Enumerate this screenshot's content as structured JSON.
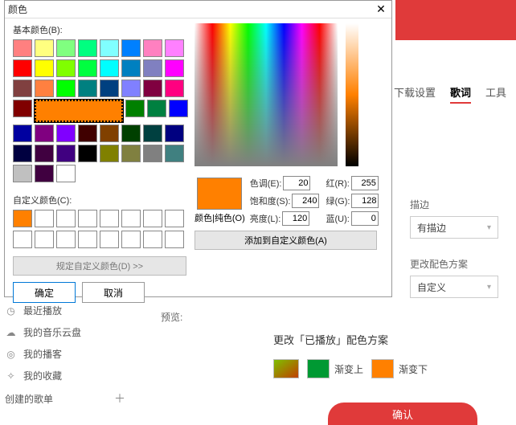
{
  "dialog": {
    "title": "颜色",
    "basic_label": "基本颜色(B):",
    "custom_label": "自定义颜色(C):",
    "define_btn": "规定自定义颜色(D) >>",
    "ok": "确定",
    "cancel": "取消",
    "preview_label": "颜色|纯色(O)",
    "add_btn": "添加到自定义颜色(A)",
    "basic_colors": [
      "#ff8080",
      "#ffff80",
      "#80ff80",
      "#00ff80",
      "#80ffff",
      "#0080ff",
      "#ff80c0",
      "#ff80ff",
      "#ff0000",
      "#ffff00",
      "#80ff00",
      "#00ff40",
      "#00ffff",
      "#0080c0",
      "#8080c0",
      "#ff00ff",
      "#804040",
      "#ff8040",
      "#00ff00",
      "#008080",
      "#004080",
      "#8080ff",
      "#800040",
      "#ff0080",
      "#800000",
      "#ff8000",
      "#008000",
      "#008040",
      "#0000ff",
      "#0000a0",
      "#800080",
      "#8000ff",
      "#400000",
      "#804000",
      "#004000",
      "#004040",
      "#000080",
      "#000040",
      "#400040",
      "#400080",
      "#000000",
      "#808000",
      "#808040",
      "#808080",
      "#408080",
      "#c0c0c0",
      "#400040",
      "#ffffff"
    ],
    "selected_index": 25,
    "custom_colors": [
      "#ff8000",
      "",
      "",
      "",
      "",
      "",
      "",
      "",
      "",
      "",
      "",
      "",
      "",
      "",
      "",
      ""
    ],
    "fields": {
      "hue_label": "色调(E):",
      "hue": "20",
      "sat_label": "饱和度(S):",
      "sat": "240",
      "lum_label": "亮度(L):",
      "lum": "120",
      "r_label": "红(R):",
      "r": "255",
      "g_label": "绿(G):",
      "g": "128",
      "b_label": "蓝(U):",
      "b": "0"
    }
  },
  "app": {
    "tabs": {
      "download": "下载设置",
      "lyric": "歌词",
      "tool": "工具"
    },
    "options": {
      "stroke_label": "描边",
      "stroke_value": "有描边",
      "scheme_label": "更改配色方案",
      "scheme_value": "自定义"
    },
    "sidebar": {
      "recent": "最近播放",
      "cloud": "我的音乐云盘",
      "podcast": "我的播客",
      "fav": "我的收藏",
      "created": "创建的歌单"
    },
    "preview": "预览:",
    "scheme_title": "更改「已播放」配色方案",
    "chip_a": "渐变上",
    "chip_b": "渐变下",
    "confirm": "确认"
  }
}
